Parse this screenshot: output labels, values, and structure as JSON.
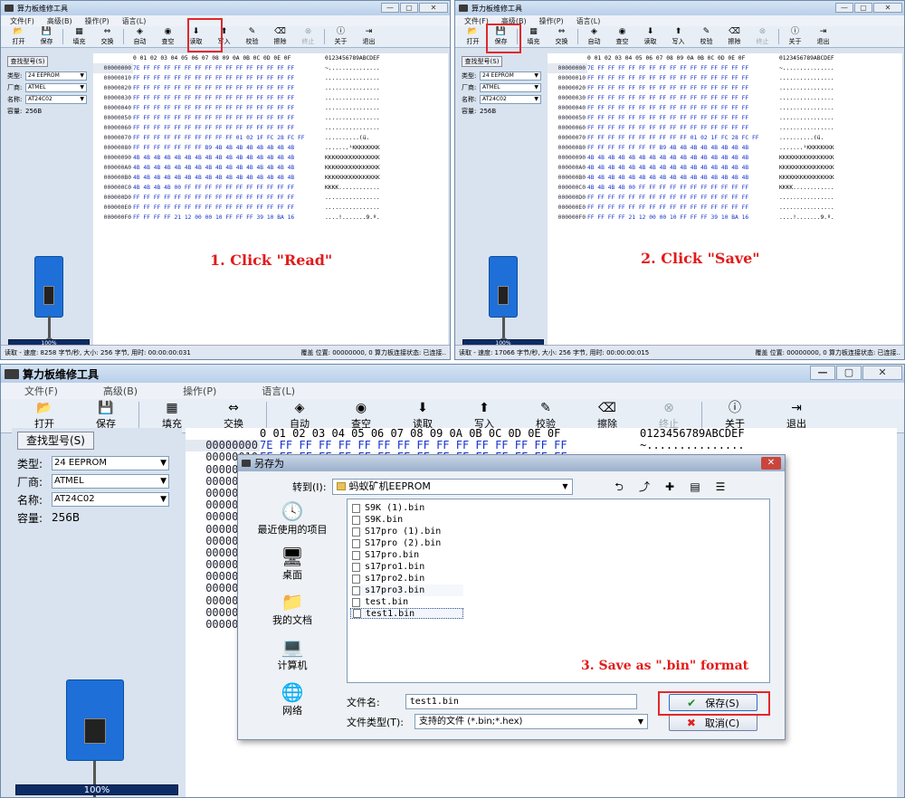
{
  "app": {
    "title": "算力板维修工具",
    "menu": [
      "文件(F)",
      "高级(B)",
      "操作(P)",
      "语言(L)"
    ],
    "toolbar": [
      {
        "label": "打开",
        "icon": "folder-open-icon",
        "glyph": "📂"
      },
      {
        "label": "保存",
        "icon": "save-icon",
        "glyph": "💾"
      },
      {
        "label": "填充",
        "icon": "fill-icon",
        "glyph": "▦"
      },
      {
        "label": "交换",
        "icon": "swap-icon",
        "glyph": "⇔"
      },
      {
        "label": "自动",
        "icon": "auto-icon",
        "glyph": "◈"
      },
      {
        "label": "查空",
        "icon": "blank-check-icon",
        "glyph": "◉"
      },
      {
        "label": "读取",
        "icon": "read-icon",
        "glyph": "⬇"
      },
      {
        "label": "写入",
        "icon": "write-icon",
        "glyph": "⬆"
      },
      {
        "label": "校验",
        "icon": "verify-icon",
        "glyph": "✎"
      },
      {
        "label": "擦除",
        "icon": "erase-icon",
        "glyph": "⌫"
      },
      {
        "label": "终止",
        "icon": "stop-icon",
        "glyph": "⊗"
      },
      {
        "label": "关于",
        "icon": "about-icon",
        "glyph": "ⓘ"
      },
      {
        "label": "退出",
        "icon": "exit-icon",
        "glyph": "⇥"
      }
    ],
    "find_button": "查找型号(S)",
    "type_label": "类型:",
    "type_value": "24 EEPROM",
    "maker_label": "厂商:",
    "maker_value": "ATMEL",
    "name_label": "名称:",
    "name_value": "AT24C02",
    "capacity_label": "容量:",
    "capacity_value": "256B",
    "progress": "100%"
  },
  "hex": {
    "header": [
      "0 01 02 03 04 05 06 07 08 09 0A 0B 0C 0D 0E 0F",
      "0123456789ABCDEF"
    ],
    "rows": [
      {
        "addr": "00000000",
        "hex": "7E FF FF FF FF FF FF FF FF FF FF FF FF FF FF FF",
        "ascii": "~..............."
      },
      {
        "addr": "00000010",
        "hex": "FF FF FF FF FF FF FF FF FF FF FF FF FF FF FF FF",
        "ascii": "................"
      },
      {
        "addr": "00000020",
        "hex": "FF FF FF FF FF FF FF FF FF FF FF FF FF FF FF FF",
        "ascii": "................"
      },
      {
        "addr": "00000030",
        "hex": "FF FF FF FF FF FF FF FF FF FF FF FF FF FF FF FF",
        "ascii": "................"
      },
      {
        "addr": "00000040",
        "hex": "FF FF FF FF FF FF FF FF FF FF FF FF FF FF FF FF",
        "ascii": "................"
      },
      {
        "addr": "00000050",
        "hex": "FF FF FF FF FF FF FF FF FF FF FF FF FF FF FF FF",
        "ascii": "................"
      },
      {
        "addr": "00000060",
        "hex": "FF FF FF FF FF FF FF FF FF FF FF FF FF FF FF FF",
        "ascii": "................"
      },
      {
        "addr": "00000070",
        "hex": "FF FF FF FF FF FF FF FF FF FF 01 02 1F FC 28 FC FF",
        "ascii": "..........(ü."
      },
      {
        "addr": "00000080",
        "hex": "FF FF FF FF FF FF FF B9 4B 4B 4B 4B 4B 4B 4B 4B",
        "ascii": ".......¹KKKKKKKK"
      },
      {
        "addr": "00000090",
        "hex": "4B 4B 4B 4B 4B 4B 4B 4B 4B 4B 4B 4B 4B 4B 4B 4B",
        "ascii": "KKKKKKKKKKKKKKKK"
      },
      {
        "addr": "000000A0",
        "hex": "4B 4B 4B 4B 4B 4B 4B 4B 4B 4B 4B 4B 4B 4B 4B 4B",
        "ascii": "KKKKKKKKKKKKKKKK"
      },
      {
        "addr": "000000B0",
        "hex": "4B 4B 4B 4B 4B 4B 4B 4B 4B 4B 4B 4B 4B 4B 4B 4B",
        "ascii": "KKKKKKKKKKKKKKKK"
      },
      {
        "addr": "000000C0",
        "hex": "4B 4B 4B 4B 00 FF FF FF FF FF FF FF FF FF FF FF",
        "ascii": "KKKK............"
      },
      {
        "addr": "000000D0",
        "hex": "FF FF FF FF FF FF FF FF FF FF FF FF FF FF FF FF",
        "ascii": "................"
      },
      {
        "addr": "000000E0",
        "hex": "FF FF FF FF FF FF FF FF FF FF FF FF FF FF FF FF",
        "ascii": "................"
      },
      {
        "addr": "000000F0",
        "hex": "FF FF FF FF 21 12 00 00 10 FF FF FF 39 10 BA 16",
        "ascii": "....!.......9.º."
      }
    ]
  },
  "win1": {
    "status_left": "读取 - 速度: 8258 字节/秒, 大小: 256 字节, 用时: 00:00:00:031",
    "status_right": "覆盖  位置: 00000000, 0   算力板连接状态: 已连接..",
    "caption": "1. Click \"Read\""
  },
  "win2": {
    "status_left": "读取 - 速度: 17066 字节/秒, 大小: 256 字节, 用时: 00:00:00:015",
    "status_right": "覆盖  位置: 00000000, 0   算力板连接状态: 已连接..",
    "caption": "2. Click \"Save\""
  },
  "dialog": {
    "title": "另存为",
    "look_in_label": "转到(I):",
    "look_in_value": "蚂蚁矿机EEPROM",
    "places": [
      {
        "label": "最近使用的项目",
        "icon": "recent-items-icon",
        "glyph": "🕓"
      },
      {
        "label": "桌面",
        "icon": "desktop-icon",
        "glyph": "🖥"
      },
      {
        "label": "我的文档",
        "icon": "documents-icon",
        "glyph": "📁"
      },
      {
        "label": "计算机",
        "icon": "computer-icon",
        "glyph": "💻"
      },
      {
        "label": "网络",
        "icon": "network-icon",
        "glyph": "🌐"
      }
    ],
    "files": [
      "S9K (1).bin",
      "S9K.bin",
      "S17pro (1).bin",
      "S17pro (2).bin",
      "S17pro.bin",
      "s17pro1.bin",
      "s17pro2.bin",
      "s17pro3.bin",
      "test.bin",
      "test1.bin"
    ],
    "filename_label": "文件名:",
    "filename_value": "test1.bin",
    "filetype_label": "文件类型(T):",
    "filetype_value": "支持的文件 (*.bin;*.hex)",
    "save_button": "保存(S)",
    "cancel_button": "取消(C)",
    "caption": "3. Save as \".bin\" format"
  }
}
